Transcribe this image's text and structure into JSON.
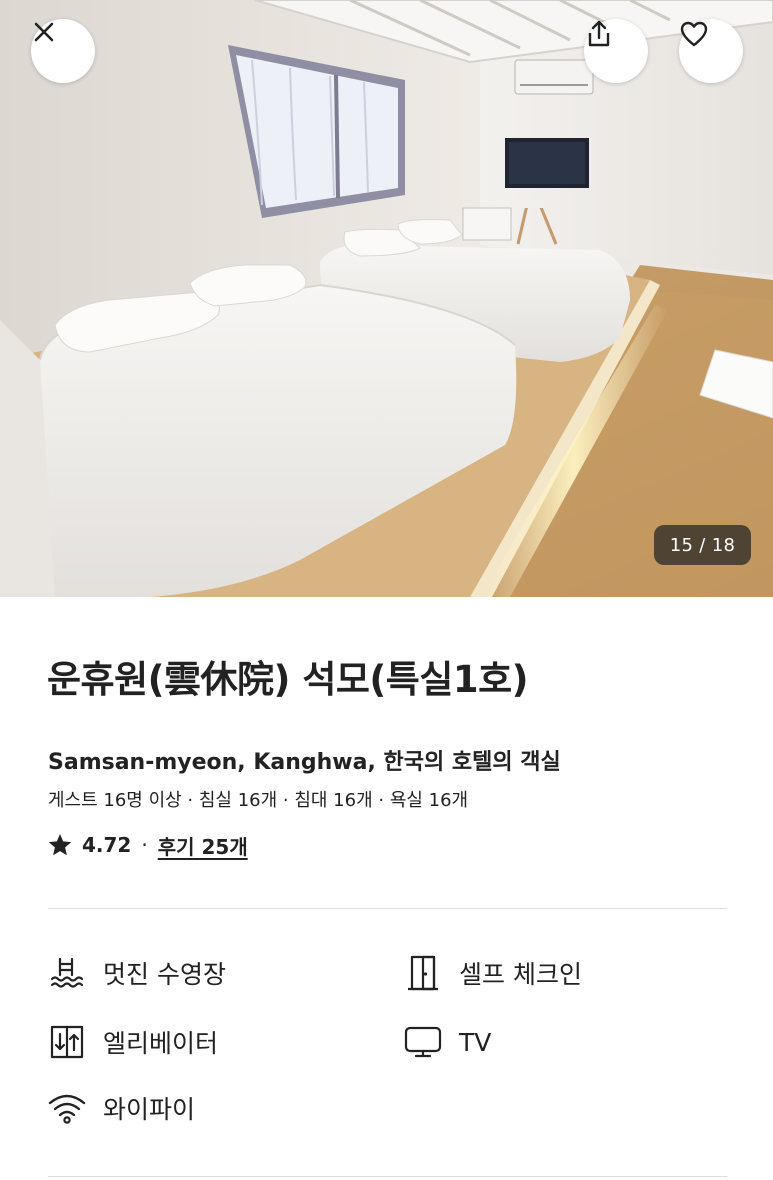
{
  "header": {
    "close_icon": "close-icon",
    "share_icon": "share-icon",
    "favorite_icon": "heart-icon"
  },
  "gallery": {
    "counter": "15 / 18"
  },
  "listing": {
    "title": "운휴원(雲休院) 석모(특실1호)",
    "location": "Samsan-myeon, Kanghwa, 한국의 호텔의 객실",
    "capacity": "게스트 16명 이상 · 침실 16개 · 침대 16개 · 욕실 16개",
    "rating": "4.72",
    "rating_separator": "·",
    "reviews_link": "후기 25개"
  },
  "amenities": [
    {
      "icon": "pool-icon",
      "label": "멋진 수영장"
    },
    {
      "icon": "door-icon",
      "label": "셀프 체크인"
    },
    {
      "icon": "elevator-icon",
      "label": "엘리베이터"
    },
    {
      "icon": "tv-icon",
      "label": "TV"
    },
    {
      "icon": "wifi-icon",
      "label": "와이파이"
    }
  ],
  "colors": {
    "text": "#222222",
    "divider": "#DDDDDD",
    "counter_bg": "#222222"
  }
}
